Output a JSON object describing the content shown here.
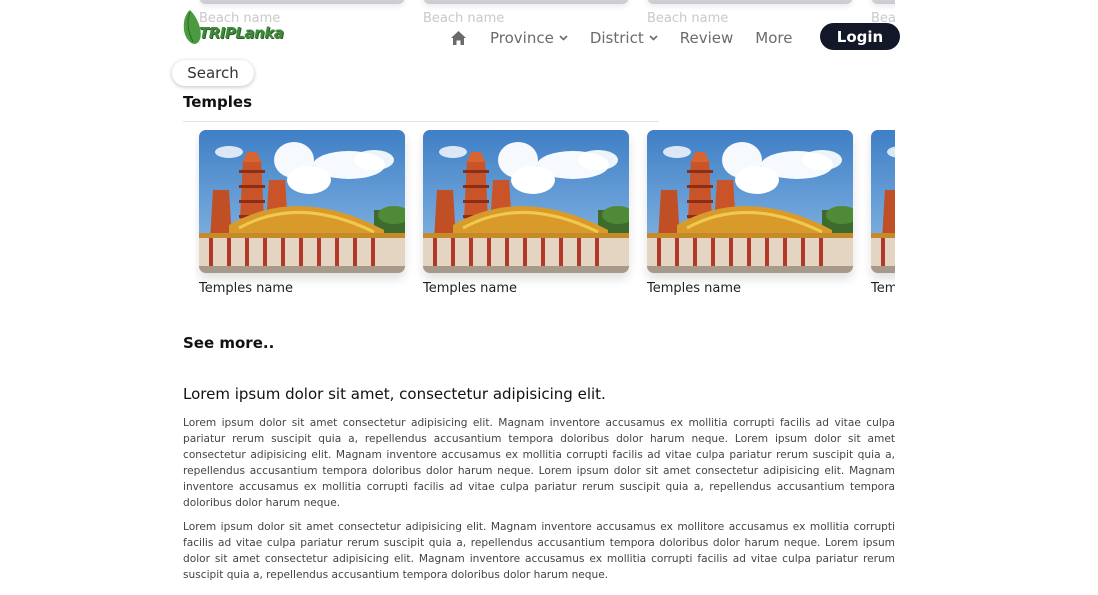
{
  "app": {
    "brand": "TRIPLanka"
  },
  "beaches": {
    "items": [
      {
        "name": "Beach name"
      },
      {
        "name": "Beach name"
      },
      {
        "name": "Beach name"
      },
      {
        "name": "Beach name"
      }
    ]
  },
  "nav": {
    "home_icon": "home-icon",
    "items": [
      {
        "label": "Province",
        "dropdown": true
      },
      {
        "label": "District",
        "dropdown": true
      },
      {
        "label": "Review",
        "dropdown": false
      },
      {
        "label": "More",
        "dropdown": false
      }
    ],
    "login_label": "Login"
  },
  "search": {
    "label": "Search"
  },
  "temples": {
    "title": "Temples",
    "items": [
      {
        "name": "Temples name"
      },
      {
        "name": "Temples name"
      },
      {
        "name": "Temples name"
      },
      {
        "name": "Temples name"
      }
    ],
    "see_more": "See more.."
  },
  "article": {
    "title": "Lorem ipsum dolor sit amet, consectetur adipisicing elit.",
    "paragraphs": [
      "Lorem ipsum dolor sit amet consectetur adipisicing elit. Magnam inventore accusamus ex mollitia corrupti facilis ad vitae culpa pariatur rerum suscipit quia a, repellendus accusantium tempora doloribus dolor harum neque. Lorem ipsum dolor sit amet consectetur adipisicing elit. Magnam inventore accusamus ex mollitia corrupti facilis ad vitae culpa pariatur rerum suscipit quia a, repellendus accusantium tempora doloribus dolor harum neque. Lorem ipsum dolor sit amet consectetur adipisicing elit. Magnam inventore accusamus ex mollitia corrupti facilis ad vitae culpa pariatur rerum suscipit quia a, repellendus accusantium tempora doloribus dolor harum neque.",
      "Lorem ipsum dolor sit amet consectetur adipisicing elit. Magnam inventore accusamus ex mollitore accusamus ex mollitia corrupti facilis ad vitae culpa pariatur rerum suscipit quia a, repellendus accusantium tempora doloribus dolor harum neque. Lorem ipsum dolor sit amet consectetur adipisicing elit. Magnam inventore accusamus ex mollitia corrupti facilis ad vitae culpa pariatur rerum suscipit quia a, repellendus accusantium tempora doloribus dolor harum neque."
    ]
  },
  "colors": {
    "login_bg": "#121828",
    "brand_green": "#3f8a3a",
    "nav_text": "#6b6b6b"
  }
}
